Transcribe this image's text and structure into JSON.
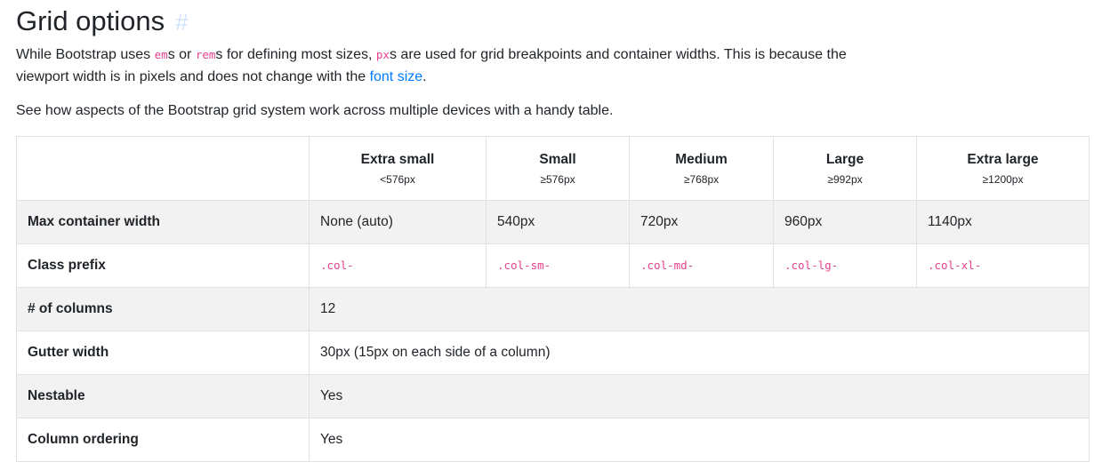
{
  "heading": {
    "title": "Grid options",
    "anchor": "#"
  },
  "intro": {
    "part1": "While Bootstrap uses ",
    "code_em": "em",
    "part2": "s or ",
    "code_rem": "rem",
    "part3": "s for defining most sizes, ",
    "code_px": "px",
    "part4": "s are used for grid breakpoints and container widths. This is because the viewport width is in pixels and does not change with the ",
    "link_text": "font size",
    "part5": "."
  },
  "see_text": "See how aspects of the Bootstrap grid system work across multiple devices with a handy table.",
  "table": {
    "columns": [
      {
        "label": "Extra small",
        "sub": "<576px"
      },
      {
        "label": "Small",
        "sub": "≥576px"
      },
      {
        "label": "Medium",
        "sub": "≥768px"
      },
      {
        "label": "Large",
        "sub": "≥992px"
      },
      {
        "label": "Extra large",
        "sub": "≥1200px"
      }
    ],
    "rows": {
      "max_width": {
        "label": "Max container width",
        "values": [
          "None (auto)",
          "540px",
          "720px",
          "960px",
          "1140px"
        ]
      },
      "class_prefix": {
        "label": "Class prefix",
        "values": [
          ".col-",
          ".col-sm-",
          ".col-md-",
          ".col-lg-",
          ".col-xl-"
        ]
      },
      "num_columns": {
        "label": "# of columns",
        "value": "12"
      },
      "gutter": {
        "label": "Gutter width",
        "value": "30px (15px on each side of a column)"
      },
      "nestable": {
        "label": "Nestable",
        "value": "Yes"
      },
      "ordering": {
        "label": "Column ordering",
        "value": "Yes"
      }
    }
  },
  "colors": {
    "code": "#e83e8c",
    "link": "#007bff",
    "anchor": "#cfe2fb",
    "stripe": "#f2f2f2",
    "border": "#dee2e6"
  }
}
